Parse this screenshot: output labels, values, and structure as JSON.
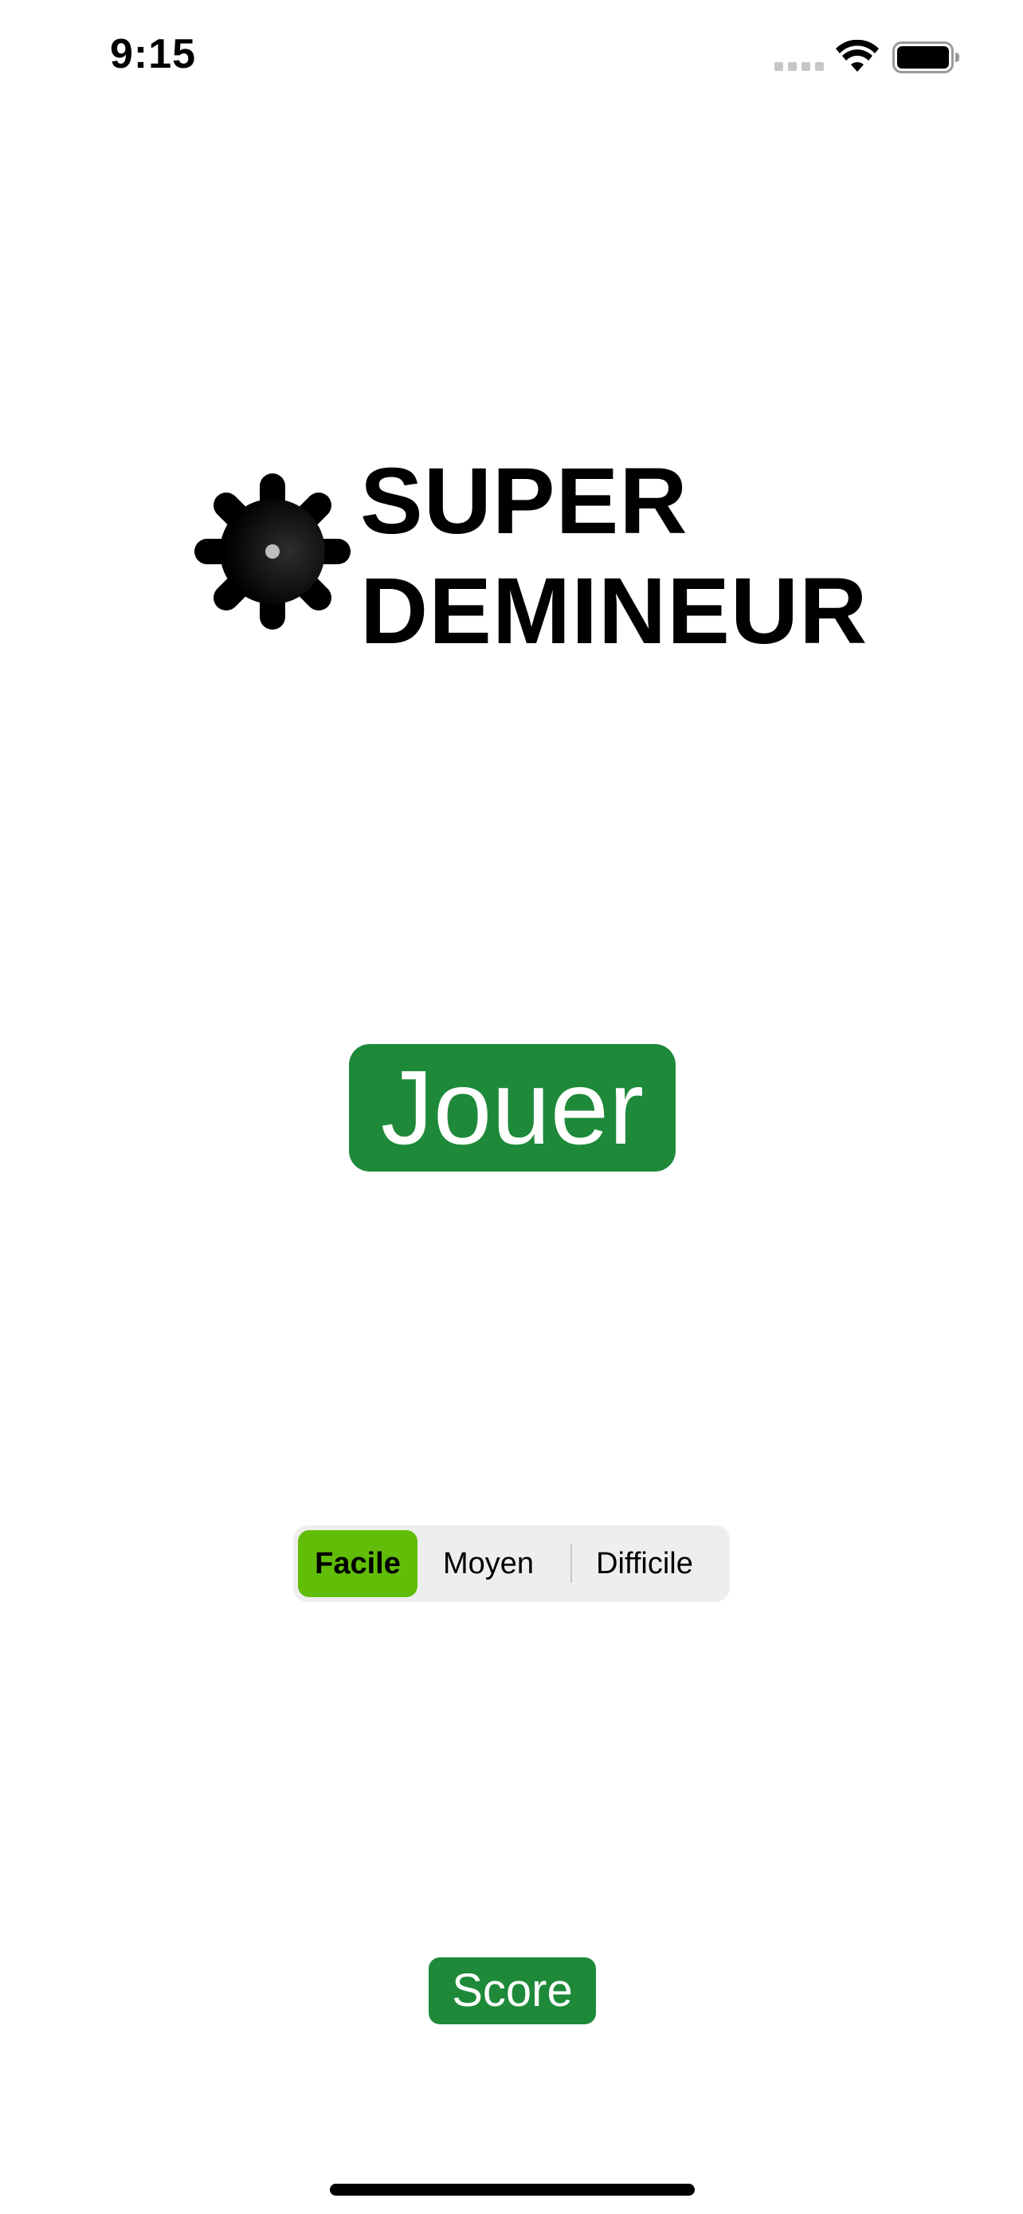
{
  "status_bar": {
    "time": "9:15",
    "icons": [
      "cellular-signal-icon",
      "wifi-icon",
      "battery-icon"
    ],
    "battery_level": 1.0
  },
  "logo": {
    "icon": "mine-icon",
    "title_line1": "SUPER",
    "title_line2": "DEMINEUR"
  },
  "play_button": {
    "label": "Jouer"
  },
  "difficulty": {
    "options": [
      "Facile",
      "Moyen",
      "Difficile"
    ],
    "selected": "Facile"
  },
  "score_button": {
    "label": "Score"
  },
  "colors": {
    "button_green": "#1e8a39",
    "selected_segment_green": "#61bd07",
    "segment_background": "#eeeeee",
    "background": "#ffffff"
  }
}
